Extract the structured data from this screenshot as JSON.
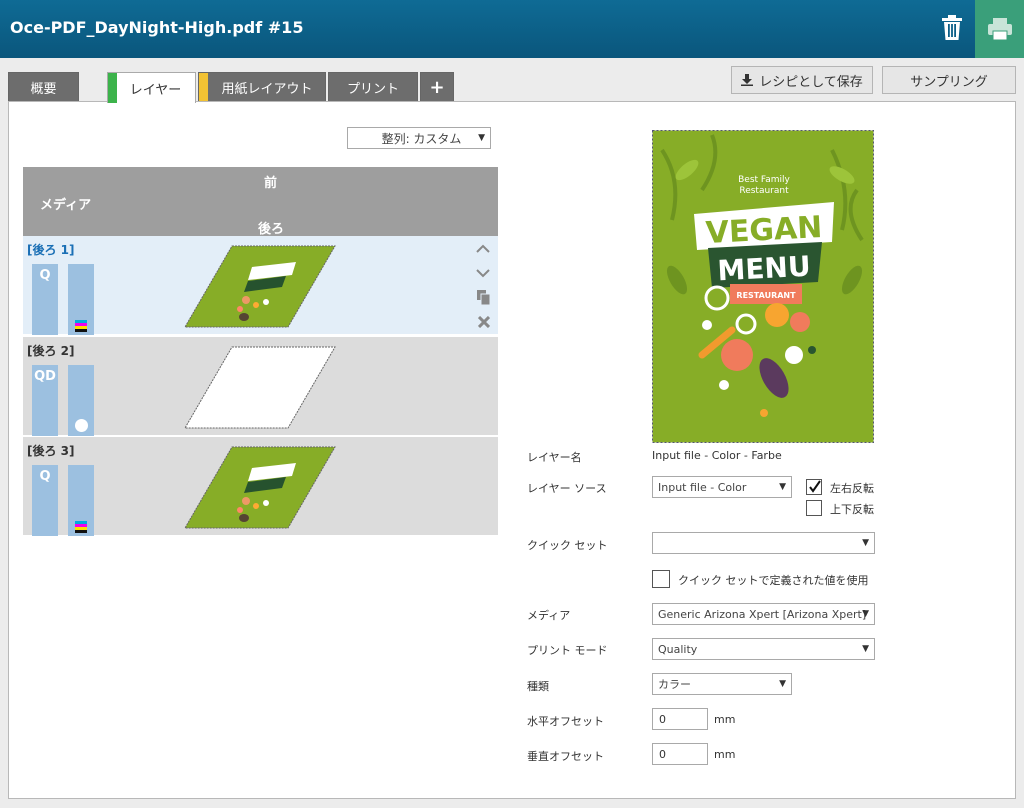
{
  "window": {
    "title": "Oce-PDF_DayNight-High.pdf #15"
  },
  "tabs": [
    {
      "label": "概要"
    },
    {
      "label": "レイヤー",
      "stripe": "#3cb34b"
    },
    {
      "label": "用紙レイアウト",
      "stripe": "#f2c233"
    },
    {
      "label": "プリント"
    },
    {
      "label": "+"
    }
  ],
  "toolbar": {
    "save_recipe": "レシピとして保存",
    "sampling": "サンプリング"
  },
  "sort": {
    "value": "整列: カスタム"
  },
  "layers_header": {
    "front": "前",
    "media": "メディア",
    "back": "後ろ"
  },
  "layers": [
    {
      "label": "[後ろ 1]",
      "mode": "Q"
    },
    {
      "label": "[後ろ 2]",
      "mode": "QD"
    },
    {
      "label": "[後ろ 3]",
      "mode": "Q"
    }
  ],
  "preview": {
    "line1": "Best Family",
    "line2": "Restaurant",
    "vegan": "VEGAN",
    "menu": "MENU",
    "restaurant": "RESTAURANT"
  },
  "form": {
    "layer_name_label": "レイヤー名",
    "layer_name_value": "Input file - Color - Farbe",
    "layer_source_label": "レイヤー ソース",
    "layer_source_value": "Input file - Color",
    "mirror_h_label": "左右反転",
    "mirror_v_label": "上下反転",
    "quickset_label": "クイック セット",
    "quickset_value": "",
    "use_quickset_label": "クイック セットで定義された値を使用",
    "media_label": "メディア",
    "media_value": "Generic Arizona Xpert [Arizona Xpert]",
    "print_mode_label": "プリント モード",
    "print_mode_value": "Quality",
    "type_label": "種類",
    "type_value": "カラー",
    "h_offset_label": "水平オフセット",
    "h_offset_value": "0",
    "v_offset_label": "垂直オフセット",
    "v_offset_value": "0",
    "unit": "mm"
  },
  "colors": {
    "titlebar": "#0a5f8a",
    "print": "#3a9f7a",
    "selected_row": "#e3eef8",
    "bar": "#9cc0e0",
    "menu_green": "#87ad27"
  }
}
